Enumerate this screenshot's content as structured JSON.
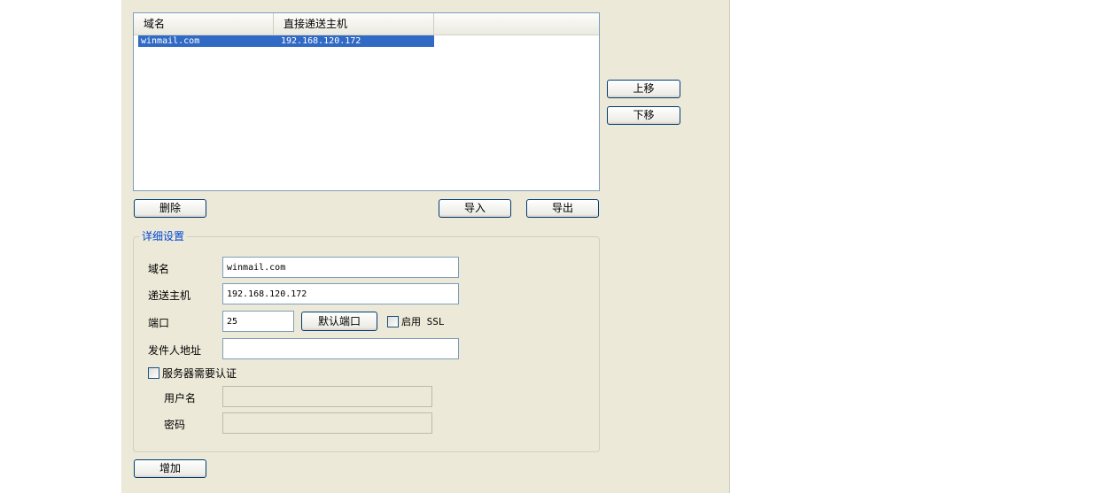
{
  "list": {
    "columns": [
      "域名",
      "直接递送主机"
    ],
    "rows": [
      {
        "domain": "winmail.com",
        "host": "192.168.120.172"
      }
    ]
  },
  "buttons": {
    "move_up": "上移",
    "move_down": "下移",
    "delete": "删除",
    "import": "导入",
    "export": "导出",
    "add": "增加",
    "default_port": "默认端口"
  },
  "details": {
    "legend": "详细设置",
    "domain_label": "域名",
    "domain_value": "winmail.com",
    "host_label": "递送主机",
    "host_value": "192.168.120.172",
    "port_label": "端口",
    "port_value": "25",
    "ssl_label": "启用 SSL",
    "ssl_checked": false,
    "sender_label": "发件人地址",
    "sender_value": "",
    "auth_label": "服务器需要认证",
    "auth_checked": false,
    "username_label": "用户名",
    "username_value": "",
    "password_label": "密码",
    "password_value": ""
  },
  "colors": {
    "panel_bg": "#ECE9D8",
    "selection": "#316AC5",
    "legend_text": "#0046D5",
    "button_border": "#003C74",
    "input_border": "#7F9DB9"
  }
}
